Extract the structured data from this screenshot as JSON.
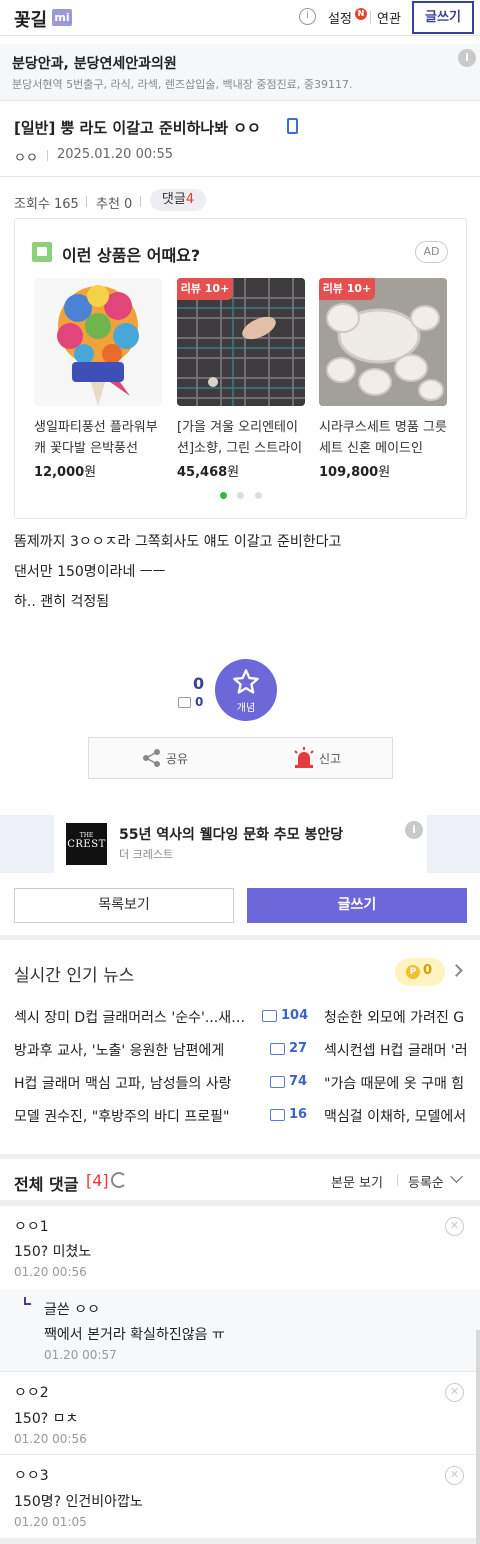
{
  "header": {
    "logo": "꽃길",
    "logo_badge": "mi",
    "settings": "설정",
    "new_badge": "N",
    "link": "연관",
    "write": "글쓰기"
  },
  "clinic_ad": {
    "title": "분당안과, 분당연세안과의원",
    "desc": "분당서현역 5번출구, 라식, 라섹, 렌즈삽입술, 백내장 중점진료, 중39117."
  },
  "post": {
    "title": "[일반] 뿡 라도 이갈고 준비하나봐 ㅇㅇ",
    "author": "ㅇㅇ",
    "date": "2025.01.20 00:55",
    "views": "조회수 165",
    "recommend": "추천 0",
    "comments_label": "댓글",
    "comments_count": "4",
    "body": [
      "똠제까지 3ㅇㅇㅈ라 그쪽회사도 얘도 이갈고 준비한다고",
      "댄서만 150명이라네 ㅡㅡ",
      "하.. 괜히 걱정됨"
    ],
    "likes": "0",
    "like_sub": "0",
    "star_label": "개념",
    "share": "공유",
    "report": "신고"
  },
  "products": {
    "heading": "이런 상품은 어때요?",
    "ad": "AD",
    "items": [
      {
        "name": "생일파티풍선 플라워부캐 꽃다발 은박풍선",
        "price": "12,000",
        "unit": "원",
        "tag": ""
      },
      {
        "name": "[가을 겨울 오리엔테이션]소향, 그린 스트라이프",
        "price": "45,468",
        "unit": "원",
        "tag": "리뷰 10+"
      },
      {
        "name": "시라쿠스세트 명품 그릇세트 신혼 메이드인",
        "price": "109,800",
        "unit": "원",
        "tag": "리뷰 10+"
      }
    ]
  },
  "crest_ad": {
    "logo_top": "THE",
    "logo_main": "CREST",
    "title": "55년 역사의 웰다잉 문화 추모 봉안당",
    "desc": "더 크레스트"
  },
  "buttons": {
    "list": "목록보기",
    "write": "글쓰기"
  },
  "news": {
    "heading": "실시간 인기 뉴스",
    "points": "0",
    "left": [
      {
        "title": "섹시 장미 D컵 글래머러스 '순수'...새로운",
        "count": "104"
      },
      {
        "title": "방과후 교사, '노출' 응원한 남편에게",
        "count": "27"
      },
      {
        "title": "H컵 글래머 맥심 고파, 남성들의 사랑",
        "count": "74"
      },
      {
        "title": "모델 권수진, \"후방주의 바디 프로필\"",
        "count": "16"
      }
    ],
    "right": [
      "청순한 외모에 가려진 G",
      "섹시컨셉 H컵 글래머 '러",
      "\"가슴 때문에 옷 구매 힘",
      "맥심걸 이채하, 모델에서"
    ]
  },
  "comments": {
    "heading": "전체 댓글",
    "count": "[4]",
    "view_body": "본문 보기",
    "sort": "등록순",
    "items": [
      {
        "name": "ㅇㅇ1",
        "text": "150? 미쳤노",
        "date": "01.20 00:56"
      },
      {
        "name": "글쓴 ㅇㅇ",
        "text": "짹에서 본거라 확실하진않음 ㅠ",
        "date": "01.20 00:57"
      },
      {
        "name": "ㅇㅇ2",
        "text": "150? ㅁㅊ",
        "date": "01.20 00:56"
      },
      {
        "name": "ㅇㅇ3",
        "text": "150명? 인건비아깝노",
        "date": "01.20 01:05"
      }
    ]
  },
  "colors": {
    "brand": "#3b3f98",
    "accent": "#6c68d9",
    "red": "#e03c3c"
  }
}
